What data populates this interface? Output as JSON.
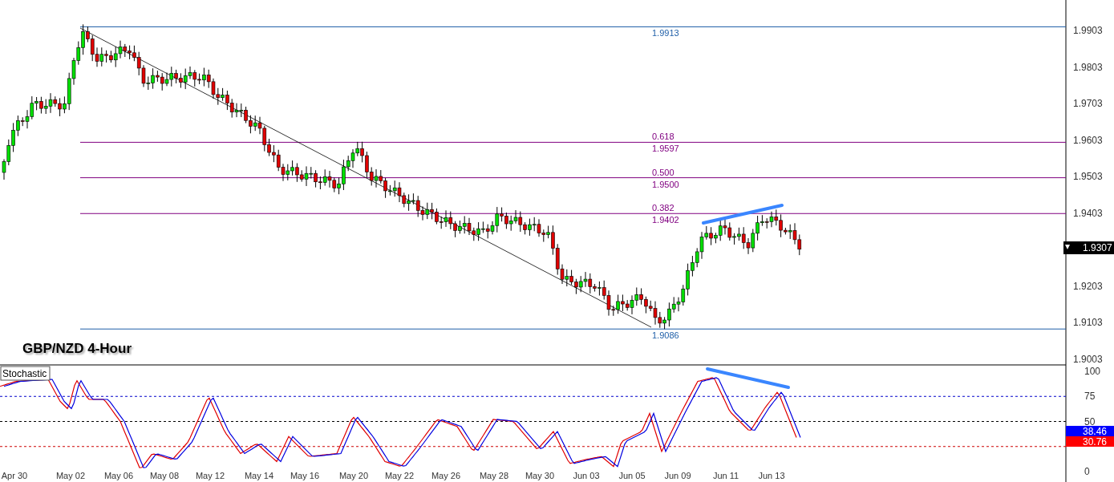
{
  "chart_title": "GBP/NZD 4-Hour",
  "price_axis": {
    "labels": [
      "1.9903",
      "1.9803",
      "1.9703",
      "1.9603",
      "1.9503",
      "1.9403",
      "1.9203",
      "1.9103",
      "1.9003"
    ],
    "current_price": "1.9307"
  },
  "levels": [
    {
      "kind": "extreme",
      "price": "1.9913"
    },
    {
      "kind": "fib",
      "ratio": "0.618",
      "price": "1.9597"
    },
    {
      "kind": "fib",
      "ratio": "0.500",
      "price": "1.9500"
    },
    {
      "kind": "fib",
      "ratio": "0.382",
      "price": "1.9402"
    },
    {
      "kind": "extreme",
      "price": "1.9086"
    }
  ],
  "indicator": {
    "name": "Stochastic",
    "axis_labels": [
      "100",
      "75",
      "50",
      "0"
    ],
    "readouts": [
      {
        "value": "38.46",
        "color": "#0000ff"
      },
      {
        "value": "30.76",
        "color": "#ff0000"
      }
    ]
  },
  "date_labels": [
    "Apr 30",
    "May 02",
    "May 06",
    "May 08",
    "May 12",
    "May 14",
    "May 16",
    "May 20",
    "May 22",
    "May 26",
    "May 28",
    "May 30",
    "Jun 03",
    "Jun 05",
    "Jun 09",
    "Jun 11",
    "Jun 13"
  ]
}
